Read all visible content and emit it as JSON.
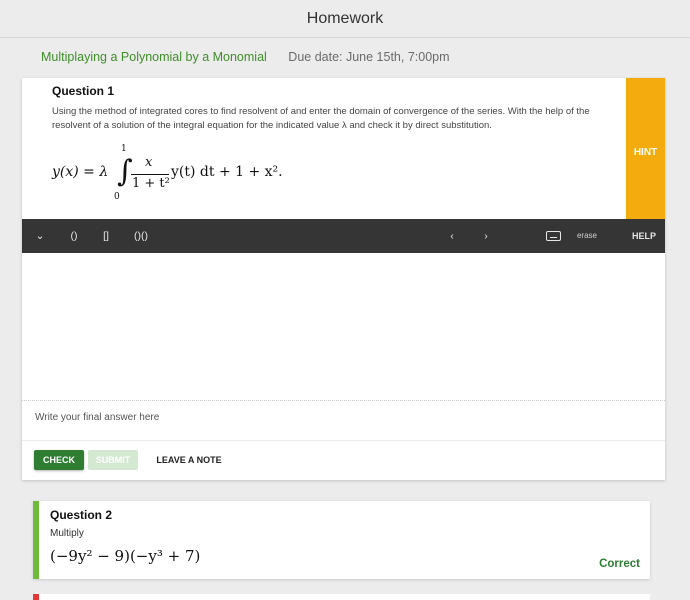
{
  "header": {
    "title": "Homework"
  },
  "assignment": {
    "name": "Multiplaying a Polynomial by a Monomial",
    "due": "Due date: June 15th, 7:00pm"
  },
  "question1": {
    "title": "Question 1",
    "text": "Using the method of integrated cores to find resolvent of and enter the domain of convergence of the series. With the help of the resolvent of a solution of the integral equation for the indicated value  λ and check it by direct substitution.",
    "equation": {
      "lhs": "y(x) = λ",
      "upper": "1",
      "lower": "0",
      "numerator": "x",
      "denominator": "1 + t²",
      "tail": "y(t) dt + 1 + x².",
      "integral": "∫"
    },
    "hint_label": "HINT",
    "toolbar": {
      "caret": "⌄",
      "paren": "()",
      "bracket": "[]",
      "func": "()()",
      "left": "‹",
      "right": "›",
      "erase": "erase",
      "help": "HELP",
      "keyboard_icon": "keyboard-icon"
    },
    "final_placeholder": "Write your final answer here",
    "buttons": {
      "check": "CHECK",
      "submit": "SUBMIT",
      "note": "LEAVE A NOTE"
    }
  },
  "question2": {
    "title": "Question 2",
    "instruction": "Multiply",
    "expression": "(−9y² − 9)(−y³ + 7)",
    "status": "Correct"
  },
  "colors": {
    "accent_green": "#3f8e2a",
    "check_green": "#2e7d32",
    "hint_orange": "#f4ab0e",
    "correct_bar": "#6dbb3a",
    "error_bar": "#e53935",
    "toolbar_dark": "#353535"
  }
}
